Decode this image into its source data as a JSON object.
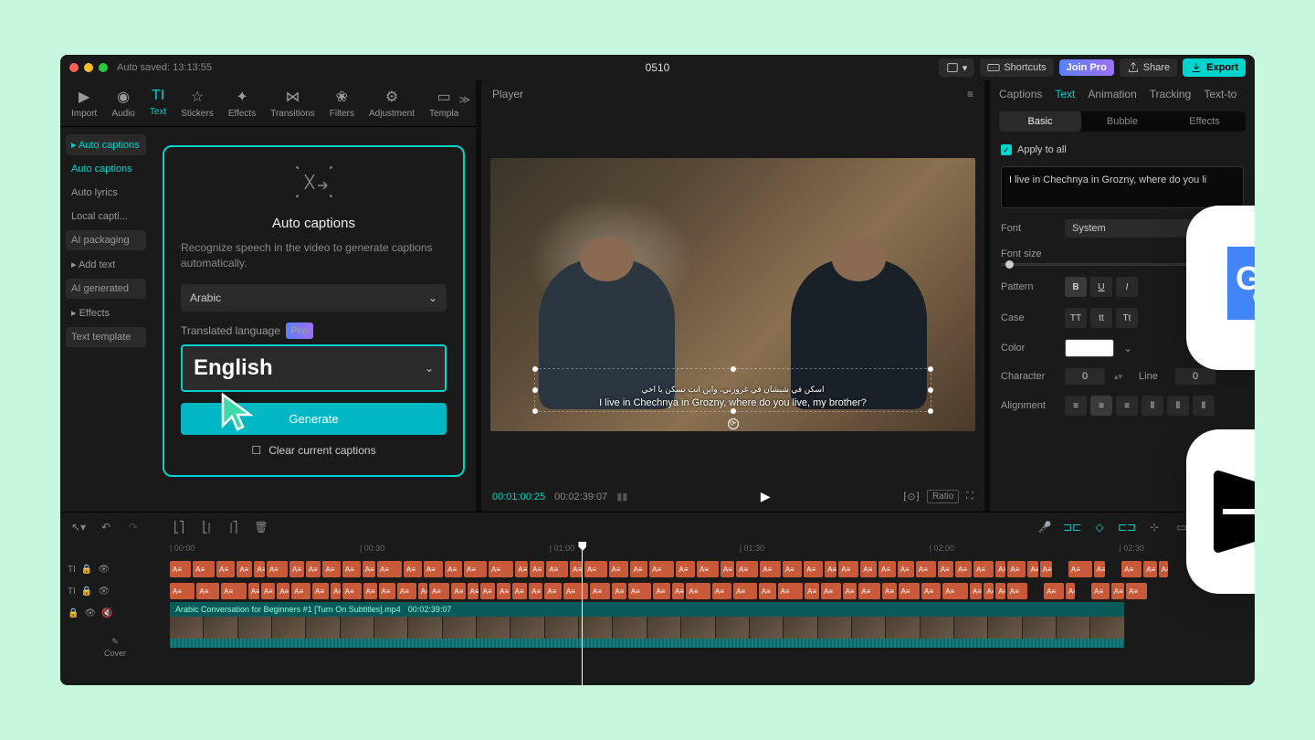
{
  "titlebar": {
    "autosaved": "Auto saved: 13:13:55",
    "title": "0510",
    "shortcuts": "Shortcuts",
    "joinpro": "Join Pro",
    "share": "Share",
    "export": "Export"
  },
  "toolbar": [
    "Import",
    "Audio",
    "Text",
    "Stickers",
    "Effects",
    "Transitions",
    "Filters",
    "Adjustment",
    "Templa"
  ],
  "toolbar_active": 2,
  "sidebar": [
    {
      "label": "Auto captions",
      "type": "header"
    },
    {
      "label": "Auto captions",
      "type": "item",
      "sel": true
    },
    {
      "label": "Auto lyrics",
      "type": "item"
    },
    {
      "label": "Local capti...",
      "type": "item"
    },
    {
      "label": "AI packaging",
      "type": "group"
    },
    {
      "label": "Add text",
      "type": "header"
    },
    {
      "label": "AI generated",
      "type": "group"
    },
    {
      "label": "Effects",
      "type": "header"
    },
    {
      "label": "Text template",
      "type": "group"
    }
  ],
  "panel": {
    "title": "Auto captions",
    "desc": "Recognize speech in the video to generate captions automatically.",
    "lang": "Arabic",
    "trans_label": "Translated language",
    "pro": "Pro",
    "trans_lang": "English",
    "generate": "Generate",
    "clear": "Clear current captions"
  },
  "player": {
    "label": "Player",
    "caption_ar": "اسكن في شيشان في غروزني، واين انت تسكن يا اخي",
    "caption_en": "I live in Chechnya in Grozny, where do you live, my brother?",
    "tc_current": "00:01:00:25",
    "tc_total": "00:02:39:07",
    "ratio": "Ratio"
  },
  "props": {
    "tabs": [
      "Captions",
      "Text",
      "Animation",
      "Tracking",
      "Text-to"
    ],
    "tab_active": 1,
    "subtabs": [
      "Basic",
      "Bubble",
      "Effects"
    ],
    "subtab_active": 0,
    "apply_all": "Apply to all",
    "text_value": "I live in Chechnya in Grozny, where do you li",
    "font_label": "Font",
    "font_value": "System",
    "fontsize_label": "Font size",
    "pattern_label": "Pattern",
    "case_label": "Case",
    "case_opts": [
      "TT",
      "tt",
      "Tt"
    ],
    "color_label": "Color",
    "char_label": "Character",
    "char_val": "0",
    "line_label": "Line",
    "line_val": "0",
    "align_label": "Alignment"
  },
  "timeline": {
    "ticks": [
      "00:00",
      "00:30",
      "01:00",
      "01:30",
      "02:00",
      "02:30"
    ],
    "video_name": "Arabic Conversation for Beginners #1 [Turn On Subtitles].mp4",
    "video_dur": "00:02:39:07",
    "cover": "Cover"
  }
}
